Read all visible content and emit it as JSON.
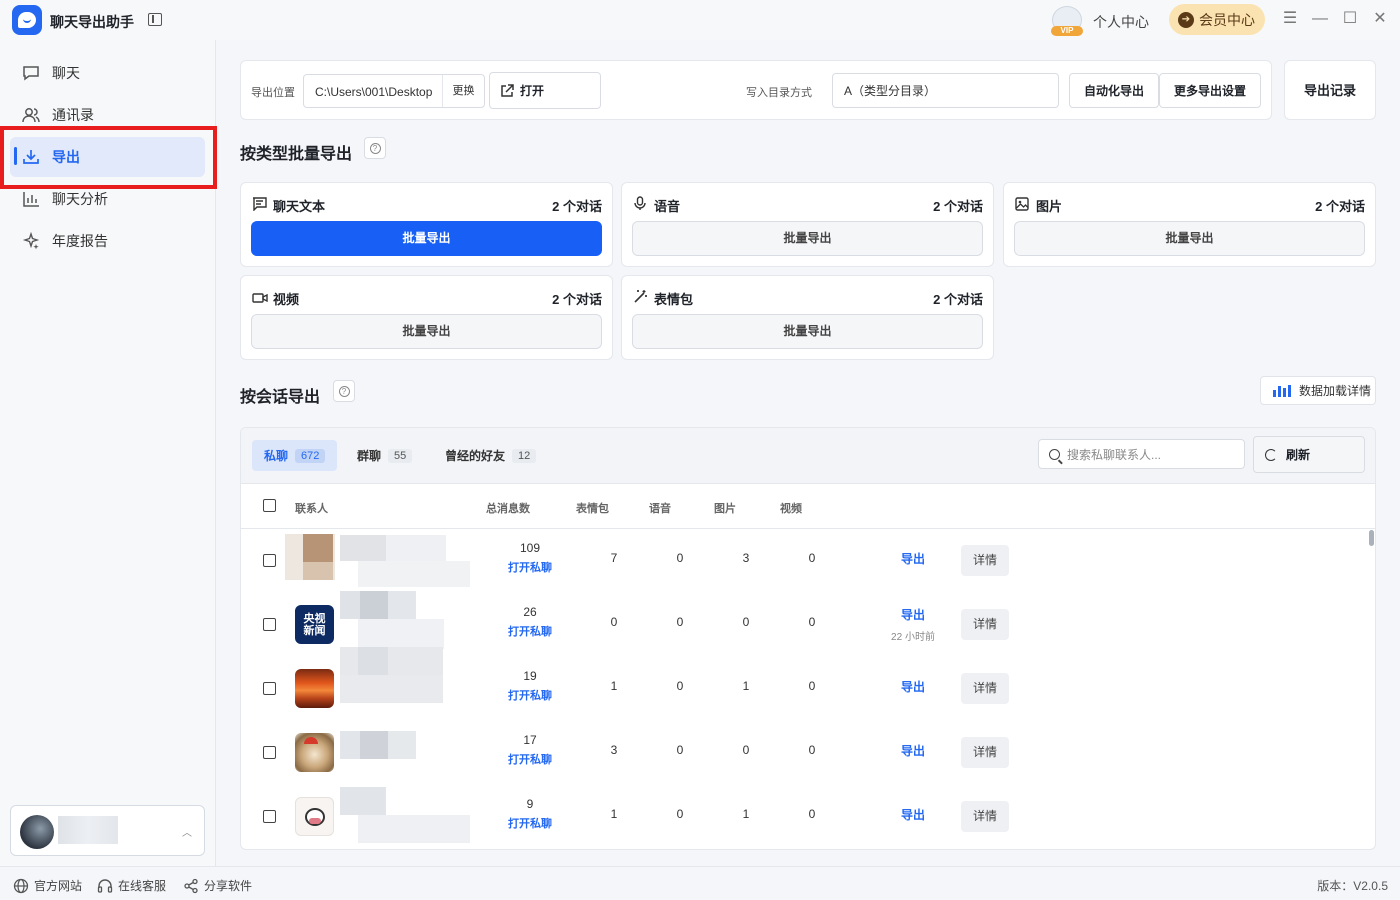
{
  "app": {
    "title": "聊天导出助手",
    "personal_center": "个人中心",
    "member_center": "会员中心",
    "vip_badge": "VIP"
  },
  "sidebar": {
    "items": [
      {
        "label": "聊天",
        "icon": "chat-bubble-icon",
        "active": false
      },
      {
        "label": "通讯录",
        "icon": "contacts-icon",
        "active": false
      },
      {
        "label": "导出",
        "icon": "download-icon",
        "active": true
      },
      {
        "label": "聊天分析",
        "icon": "bar-chart-icon",
        "active": false
      },
      {
        "label": "年度报告",
        "icon": "sparkle-icon",
        "active": false
      }
    ]
  },
  "footer": {
    "links": [
      "官方网站",
      "在线客服",
      "分享软件"
    ],
    "version": "版本：V2.0.5"
  },
  "toolbar": {
    "export_location_label": "导出位置",
    "path": "C:\\Users\\001\\Desktop",
    "change_label": "更换",
    "open_label": "打开",
    "dir_mode_label": "写入目录方式",
    "dir_mode_value": "A（类型分目录）",
    "auto_export_label": "自动化导出",
    "more_settings_label": "更多导出设置",
    "export_records_label": "导出记录"
  },
  "batch_section": {
    "title": "按类型批量导出",
    "button_label": "批量导出",
    "cards": [
      {
        "name": "聊天文本",
        "count": "2 个对话",
        "icon": "message-text-icon",
        "primary": true
      },
      {
        "name": "语音",
        "count": "2 个对话",
        "icon": "microphone-icon",
        "primary": false
      },
      {
        "name": "图片",
        "count": "2 个对话",
        "icon": "image-icon",
        "primary": false
      },
      {
        "name": "视频",
        "count": "2 个对话",
        "icon": "video-icon",
        "primary": false
      },
      {
        "name": "表情包",
        "count": "2 个对话",
        "icon": "magic-wand-icon",
        "primary": false
      }
    ]
  },
  "session_section": {
    "title": "按会话导出",
    "load_details_label": "数据加载详情",
    "tabs": [
      {
        "label": "私聊",
        "count": "672",
        "active": true
      },
      {
        "label": "群聊",
        "count": "55",
        "active": false
      },
      {
        "label": "曾经的好友",
        "count": "12",
        "active": false
      }
    ],
    "search_placeholder": "搜索私聊联系人...",
    "refresh_label": "刷新",
    "columns": [
      "联系人",
      "总消息数",
      "表情包",
      "语音",
      "图片",
      "视频"
    ],
    "open_chat_label": "打开私聊",
    "export_label": "导出",
    "detail_label": "详情",
    "rows": [
      {
        "total": "109",
        "emoji": "7",
        "voice": "0",
        "image": "3",
        "video": "0",
        "time": ""
      },
      {
        "total": "26",
        "emoji": "0",
        "voice": "0",
        "image": "0",
        "video": "0",
        "time": "22 小时前",
        "avatar_text": "央视新闻"
      },
      {
        "total": "19",
        "emoji": "1",
        "voice": "0",
        "image": "1",
        "video": "0",
        "time": ""
      },
      {
        "total": "17",
        "emoji": "3",
        "voice": "0",
        "image": "0",
        "video": "0",
        "time": ""
      },
      {
        "total": "9",
        "emoji": "1",
        "voice": "0",
        "image": "1",
        "video": "0",
        "time": ""
      }
    ]
  },
  "colors": {
    "accent": "#2468f2",
    "primary_button": "#1860f5",
    "highlight_box": "#e81d1d",
    "member_bg": "#fbe3b1"
  }
}
